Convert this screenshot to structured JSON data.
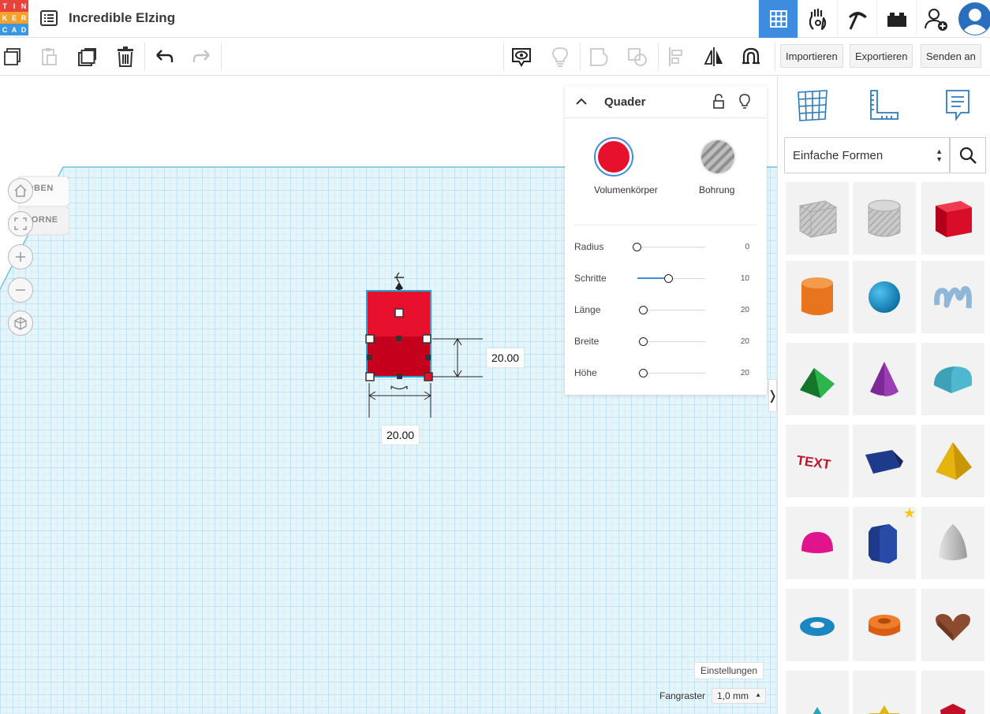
{
  "app": {
    "logo_letters": [
      "T",
      "I",
      "N",
      "K",
      "E",
      "R",
      "C",
      "A",
      "D"
    ],
    "logo_colors": [
      "#e8423c",
      "#e8423c",
      "#e8423c",
      "#f6a12c",
      "#f6a12c",
      "#f6a12c",
      "#3c96e1",
      "#3c96e1",
      "#3c96e1"
    ],
    "project_title": "Incredible Elzing",
    "accent": "#3d8ce0"
  },
  "top_nav": {
    "items": [
      "3d-design-view-icon",
      "circuits-icon",
      "minecraft-icon",
      "bricks-icon",
      "add-user-icon",
      "avatar"
    ]
  },
  "toolbar": {
    "import_label": "Importieren",
    "export_label": "Exportieren",
    "send_label": "Senden an"
  },
  "viewcube": {
    "top_label": "OBEN",
    "front_label": "VORNE"
  },
  "dimensions": {
    "height_value": "20.00",
    "width_value": "20.00"
  },
  "inspector": {
    "title": "Quader",
    "solid_label": "Volumenkörper",
    "hole_label": "Bohrung",
    "solid_color": "#e8112d",
    "props": [
      {
        "label": "Radius",
        "value": "0",
        "fraction": 0.0
      },
      {
        "label": "Schritte",
        "value": "10",
        "fraction": 0.47
      },
      {
        "label": "Länge",
        "value": "20",
        "fraction": 0.0
      },
      {
        "label": "Breite",
        "value": "20",
        "fraction": 0.0
      },
      {
        "label": "Höhe",
        "value": "20",
        "fraction": 0.0
      }
    ]
  },
  "workplane": {
    "settings_label": "Einstellungen",
    "snap_label": "Fangraster",
    "snap_value": "1,0 mm"
  },
  "library": {
    "category": "Einfache Formen",
    "shapes": [
      "box-hole-icon",
      "cylinder-hole-icon",
      "box-icon",
      "cylinder-icon",
      "sphere-icon",
      "scribble-icon",
      "roof-icon",
      "cone-icon",
      "round-roof-icon",
      "text-icon",
      "prism-icon",
      "pyramid-icon",
      "half-sphere-icon",
      "polygon-icon",
      "paraboloid-icon",
      "torus-icon",
      "tube-icon",
      "heart-icon",
      "star-icon",
      "star-yellow-icon",
      "icosahedron-icon"
    ]
  }
}
